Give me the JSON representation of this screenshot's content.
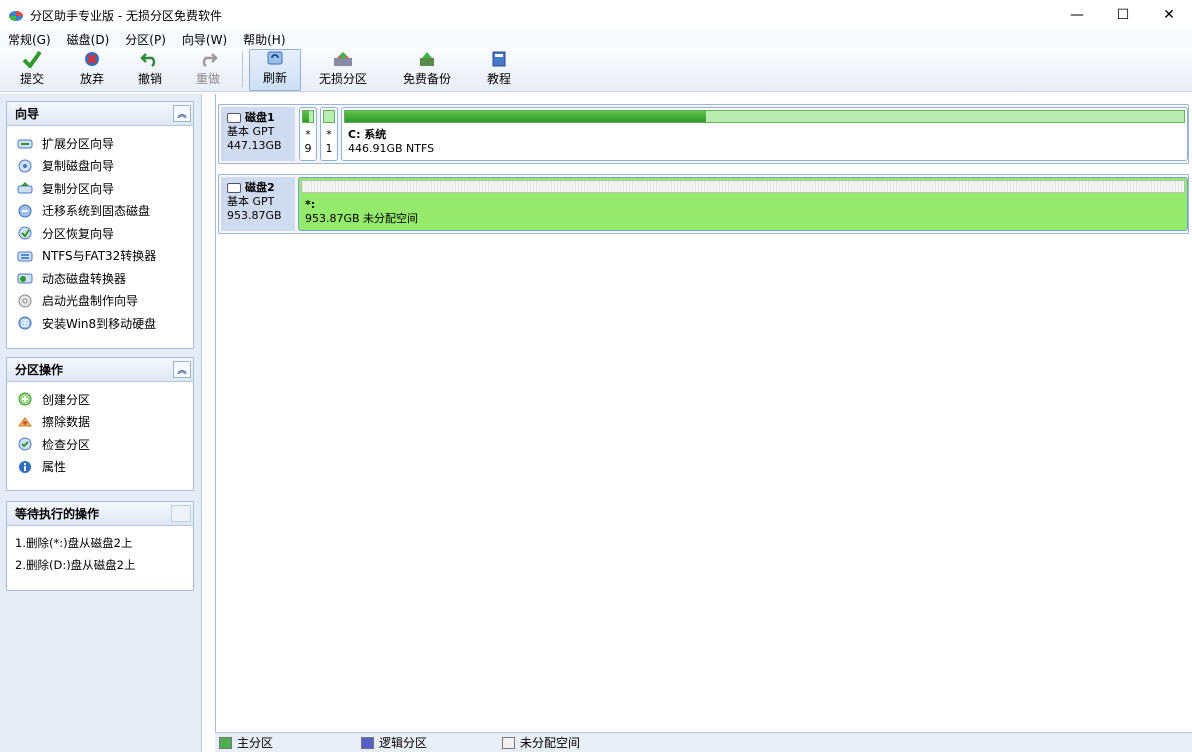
{
  "window": {
    "title": "分区助手专业版 - 无损分区免费软件",
    "minimize": "—",
    "maximize": "☐",
    "close": "✕"
  },
  "menu": [
    "常规(G)",
    "磁盘(D)",
    "分区(P)",
    "向导(W)",
    "帮助(H)"
  ],
  "toolbar": {
    "submit": "提交",
    "discard": "放弃",
    "undo": "撤销",
    "redo": "重做",
    "refresh": "刷新",
    "lossless": "无损分区",
    "backup": "免费备份",
    "tutorial": "教程"
  },
  "wizard_panel": {
    "title": "向导",
    "items": [
      "扩展分区向导",
      "复制磁盘向导",
      "复制分区向导",
      "迁移系统到固态磁盘",
      "分区恢复向导",
      "NTFS与FAT32转换器",
      "动态磁盘转换器",
      "启动光盘制作向导",
      "安装Win8到移动硬盘"
    ]
  },
  "partition_panel": {
    "title": "分区操作",
    "items": [
      "创建分区",
      "擦除数据",
      "检查分区",
      "属性"
    ]
  },
  "pending_panel": {
    "title": "等待执行的操作",
    "items": [
      "1.删除(*:)盘从磁盘2上",
      "2.删除(D:)盘从磁盘2上"
    ]
  },
  "disks": [
    {
      "name": "磁盘1",
      "type": "基本 GPT",
      "size": "447.13GB",
      "small_parts": [
        {
          "top": "*",
          "bottom": "9"
        },
        {
          "top": "*",
          "bottom": "1"
        }
      ],
      "main_part": {
        "label": "C: 系统",
        "info": "446.91GB NTFS",
        "used_fraction": 0.43
      }
    },
    {
      "name": "磁盘2",
      "type": "基本 GPT",
      "size": "953.87GB",
      "main_part": {
        "label": "*:",
        "info": "953.87GB 未分配空间"
      }
    }
  ],
  "legend": {
    "primary": "主分区",
    "logical": "逻辑分区",
    "unallocated": "未分配空间",
    "colors": {
      "primary": "#4caf50",
      "logical": "#5560c8",
      "unallocated": "#f0f0f0"
    }
  }
}
